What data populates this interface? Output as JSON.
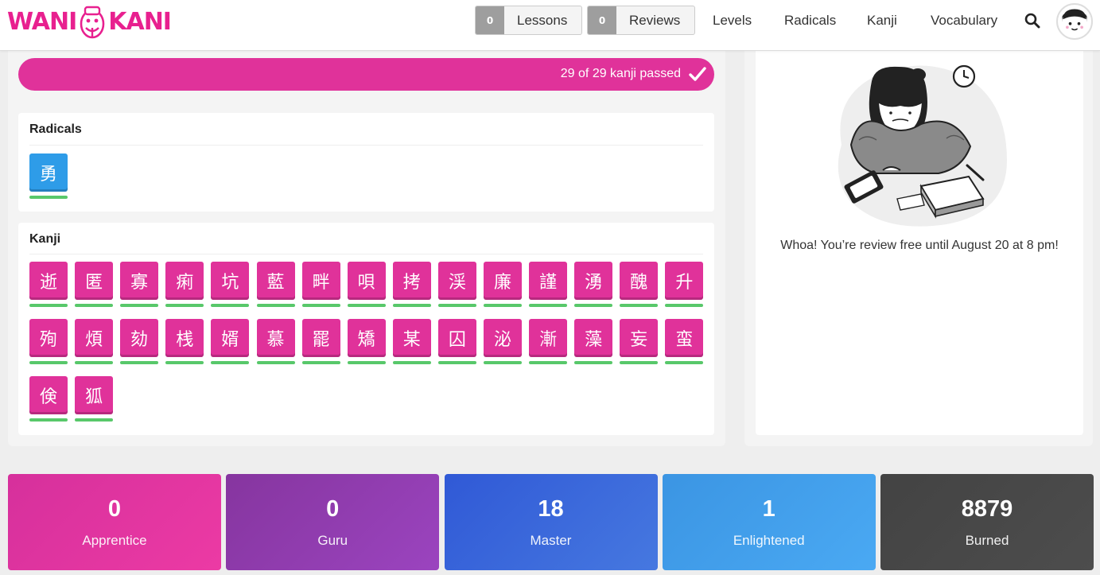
{
  "header": {
    "logo_left": "WANI",
    "logo_right": "KANI",
    "lessons": {
      "count": "0",
      "label": "Lessons"
    },
    "reviews": {
      "count": "0",
      "label": "Reviews"
    },
    "nav": [
      "Levels",
      "Radicals",
      "Kanji",
      "Vocabulary"
    ],
    "icons": {
      "search": "search-icon",
      "avatar": "avatar"
    }
  },
  "progress": {
    "text": "29 of 29 kanji passed",
    "passed": 29,
    "total": 29,
    "color": "#e0329a"
  },
  "radicals": {
    "title": "Radicals",
    "items": [
      "勇"
    ],
    "color": "#2e9ce8"
  },
  "kanji": {
    "title": "Kanji",
    "items": [
      "逝",
      "匿",
      "寡",
      "痢",
      "坑",
      "藍",
      "畔",
      "唄",
      "拷",
      "渓",
      "廉",
      "謹",
      "湧",
      "醜",
      "升",
      "殉",
      "煩",
      "劾",
      "桟",
      "婿",
      "慕",
      "罷",
      "矯",
      "某",
      "囚",
      "泌",
      "漸",
      "藻",
      "妄",
      "蛮",
      "倹",
      "狐"
    ],
    "color": "#e0329a"
  },
  "review_message": "Whoa! You’re review free until August 20 at 8 pm!",
  "stats": [
    {
      "value": "0",
      "label": "Apprentice",
      "color_from": "#d6309c",
      "color_to": "#ec3aa4"
    },
    {
      "value": "0",
      "label": "Guru",
      "color_from": "#86359f",
      "color_to": "#9b44bf"
    },
    {
      "value": "18",
      "label": "Master",
      "color_from": "#3059d6",
      "color_to": "#4678e0"
    },
    {
      "value": "1",
      "label": "Enlightened",
      "color_from": "#3b95e3",
      "color_to": "#4aa9f3"
    },
    {
      "value": "8879",
      "label": "Burned",
      "color_from": "#434343",
      "color_to": "#4d4d4d"
    }
  ]
}
